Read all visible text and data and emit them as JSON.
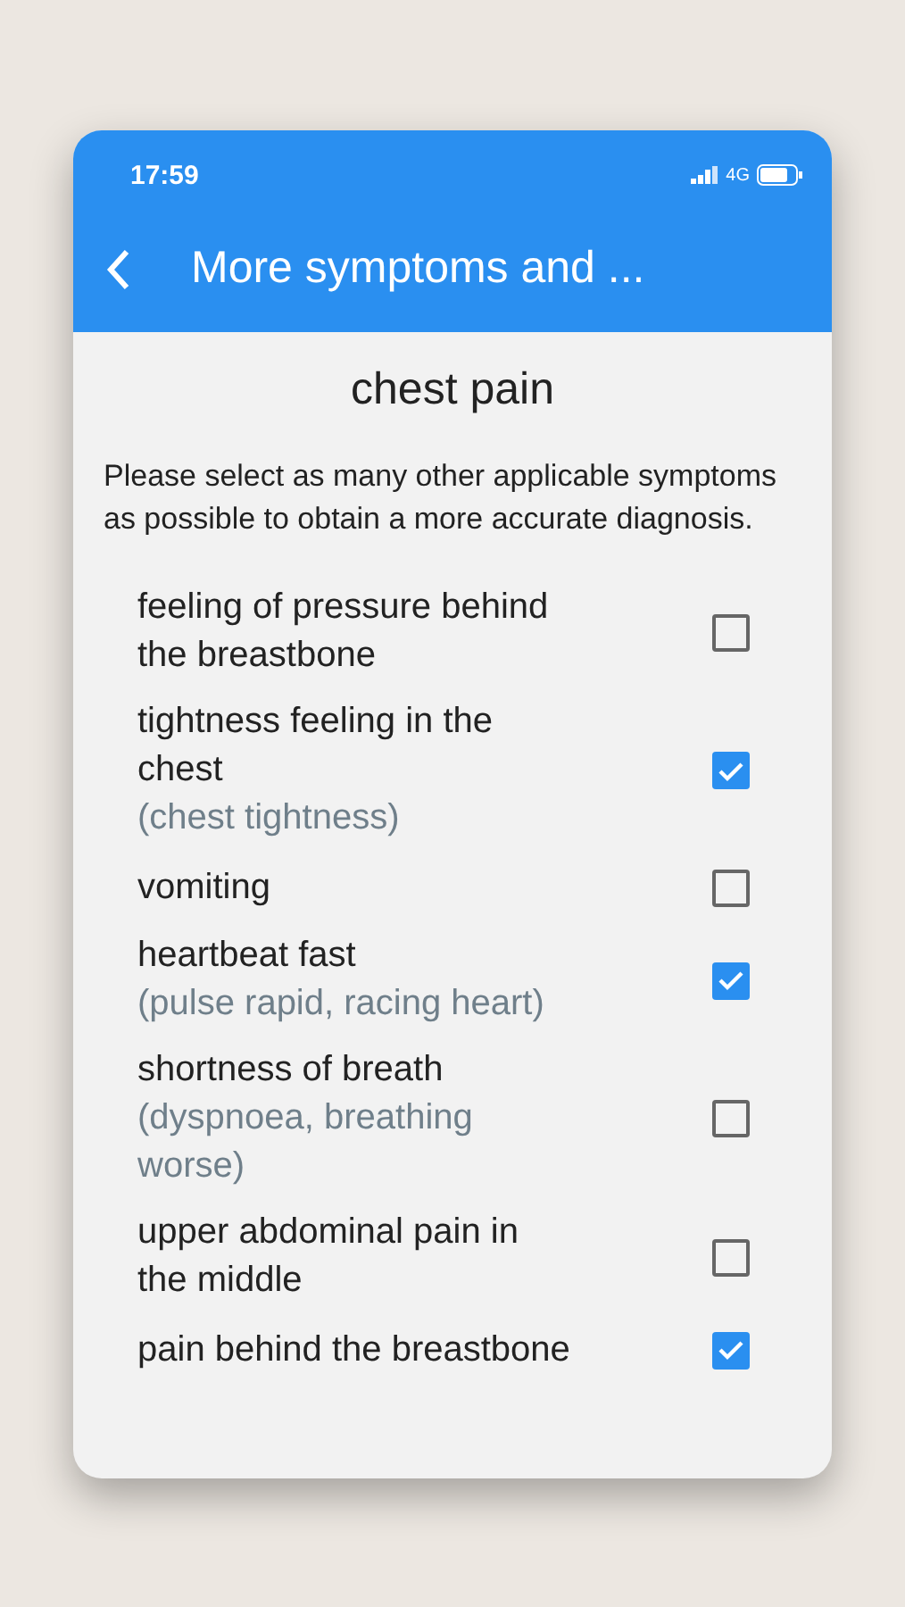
{
  "status_bar": {
    "time": "17:59",
    "network": "4G"
  },
  "app_bar": {
    "title": "More symptoms and ..."
  },
  "heading": "chest pain",
  "intro": "Please select as many other applicable symptoms as possible to obtain a more accurate diagnosis.",
  "symptoms": [
    {
      "name": "feeling of pressure behind the breastbone",
      "checked": false
    },
    {
      "name": "tightness feeling in the chest",
      "synonyms": "(chest tightness)",
      "checked": true
    },
    {
      "name": "vomiting",
      "checked": false
    },
    {
      "name": "heartbeat fast",
      "synonyms": "(pulse rapid, racing heart)",
      "checked": true
    },
    {
      "name": "shortness of breath",
      "synonyms": "(dyspnoea, breathing worse)",
      "checked": false
    },
    {
      "name": "upper abdominal pain in the middle",
      "checked": false
    },
    {
      "name": "pain behind the breastbone",
      "checked": true
    }
  ]
}
